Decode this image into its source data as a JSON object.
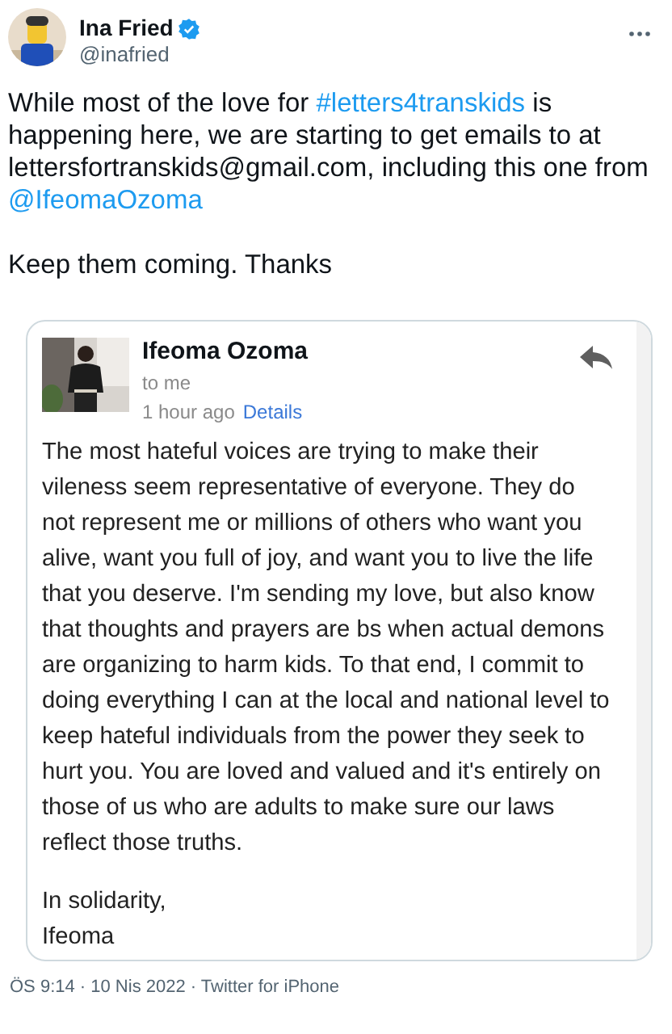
{
  "author": {
    "name": "Ina Fried",
    "verified": true,
    "handle": "@inafried"
  },
  "tweet": {
    "paragraphs": [
      [
        {
          "kind": "text",
          "text": "While most of the love for "
        },
        {
          "kind": "link",
          "text": "#letters4transkids"
        },
        {
          "kind": "text",
          "text": " is happening here, we are starting to get emails to at lettersfortranskids@gmail.com, including this one from "
        },
        {
          "kind": "link",
          "text": "@IfeomaOzoma"
        }
      ],
      [
        {
          "kind": "text",
          "text": "Keep them coming. Thanks"
        }
      ]
    ]
  },
  "email": {
    "sender": "Ifeoma Ozoma",
    "recipient": "to me",
    "time": "1 hour ago",
    "details_link": "Details",
    "body": [
      "The most hateful voices are trying to make their vileness seem representative of everyone. They do not represent me or millions of others who want you alive, want you full of joy, and want you to live the life that you deserve. I'm sending my love, but also know that thoughts and prayers are bs when actual demons are organizing to harm kids. To that end, I commit to doing everything I can at the local and national level to keep hateful individuals from the power they seek to hurt you. You are loved and valued and it's entirely on those of us who are adults to make sure our laws reflect those truths.",
      "In solidarity,",
      "Ifeoma"
    ]
  },
  "footer": {
    "timestamp": "ÖS 9:14 · 10 Nis 2022 · Twitter for iPhone"
  }
}
